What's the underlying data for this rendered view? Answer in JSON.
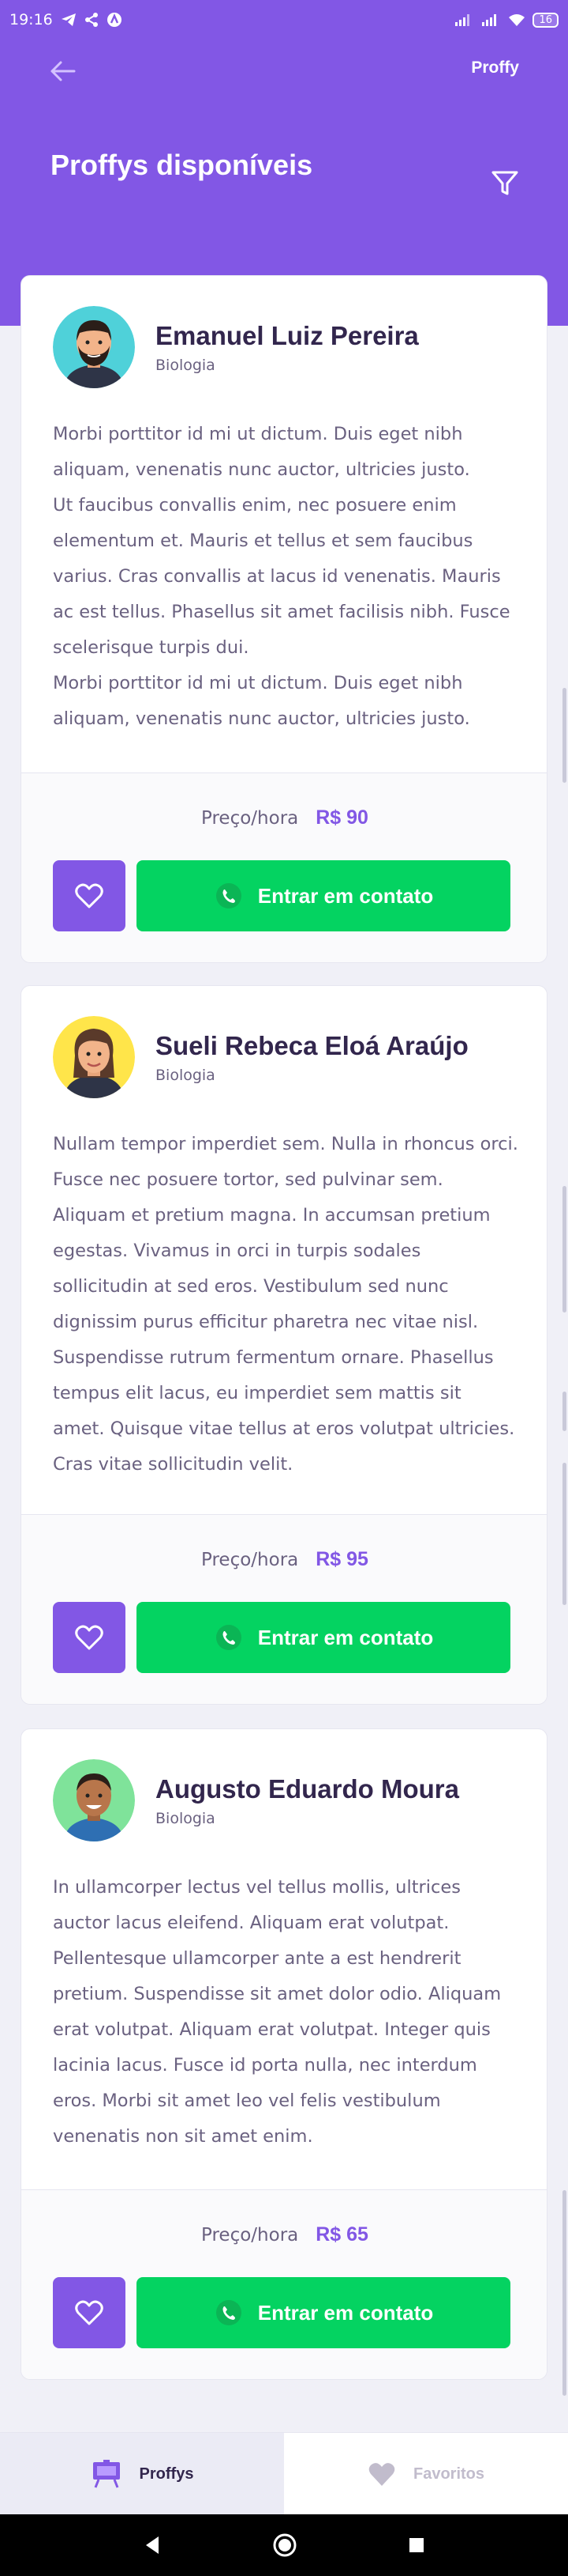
{
  "status_bar": {
    "time": "19:16",
    "battery": "16"
  },
  "header": {
    "brand": "Proffy",
    "title": "Proffys disponíveis"
  },
  "teachers": [
    {
      "name": "Emanuel Luiz Pereira",
      "subject": "Biologia",
      "bio": "Morbi porttitor id mi ut dictum. Duis eget nibh aliquam, venenatis nunc auctor, ultricies justo.\nUt faucibus convallis enim, nec posuere enim elementum et. Mauris et tellus et sem faucibus varius. Cras convallis at lacus id venenatis. Mauris ac est tellus. Phasellus sit amet facilisis nibh. Fusce scelerisque turpis dui.\nMorbi porttitor id mi ut dictum. Duis eget nibh aliquam, venenatis nunc auctor, ultricies justo.",
      "price_label": "Preço/hora",
      "price": "R$ 90",
      "contact_label": "Entrar em contato"
    },
    {
      "name": "Sueli Rebeca Eloá Araújo",
      "subject": "Biologia",
      "bio": "Nullam tempor imperdiet sem. Nulla in rhoncus orci. Fusce nec posuere tortor, sed pulvinar sem. Aliquam et pretium magna. In accumsan pretium egestas. Vivamus in orci in turpis sodales sollicitudin at sed eros. Vestibulum sed nunc dignissim purus efficitur pharetra nec vitae nisl. Suspendisse rutrum fermentum ornare. Phasellus tempus elit lacus, eu imperdiet sem mattis sit amet. Quisque vitae tellus at eros volutpat ultricies. Cras vitae sollicitudin velit.",
      "price_label": "Preço/hora",
      "price": "R$ 95",
      "contact_label": "Entrar em contato"
    },
    {
      "name": "Augusto Eduardo Moura",
      "subject": "Biologia",
      "bio": "In ullamcorper lectus vel tellus mollis, ultrices auctor lacus eleifend. Aliquam erat volutpat. Pellentesque ullamcorper ante a est hendrerit pretium. Suspendisse sit amet dolor odio. Aliquam erat volutpat. Aliquam erat volutpat. Integer quis lacinia lacus. Fusce id porta nulla, nec interdum eros. Morbi sit amet leo vel felis vestibulum venenatis non sit amet enim.",
      "price_label": "Preço/hora",
      "price": "R$ 65",
      "contact_label": "Entrar em contato"
    }
  ],
  "tabs": [
    {
      "label": "Proffys",
      "icon": "easel-icon",
      "active": true
    },
    {
      "label": "Favoritos",
      "icon": "heart-icon",
      "active": false
    }
  ],
  "colors": {
    "primary": "#8257E5",
    "secondary": "#04D361",
    "title_text": "#32264D",
    "body_text": "#6A6180"
  }
}
